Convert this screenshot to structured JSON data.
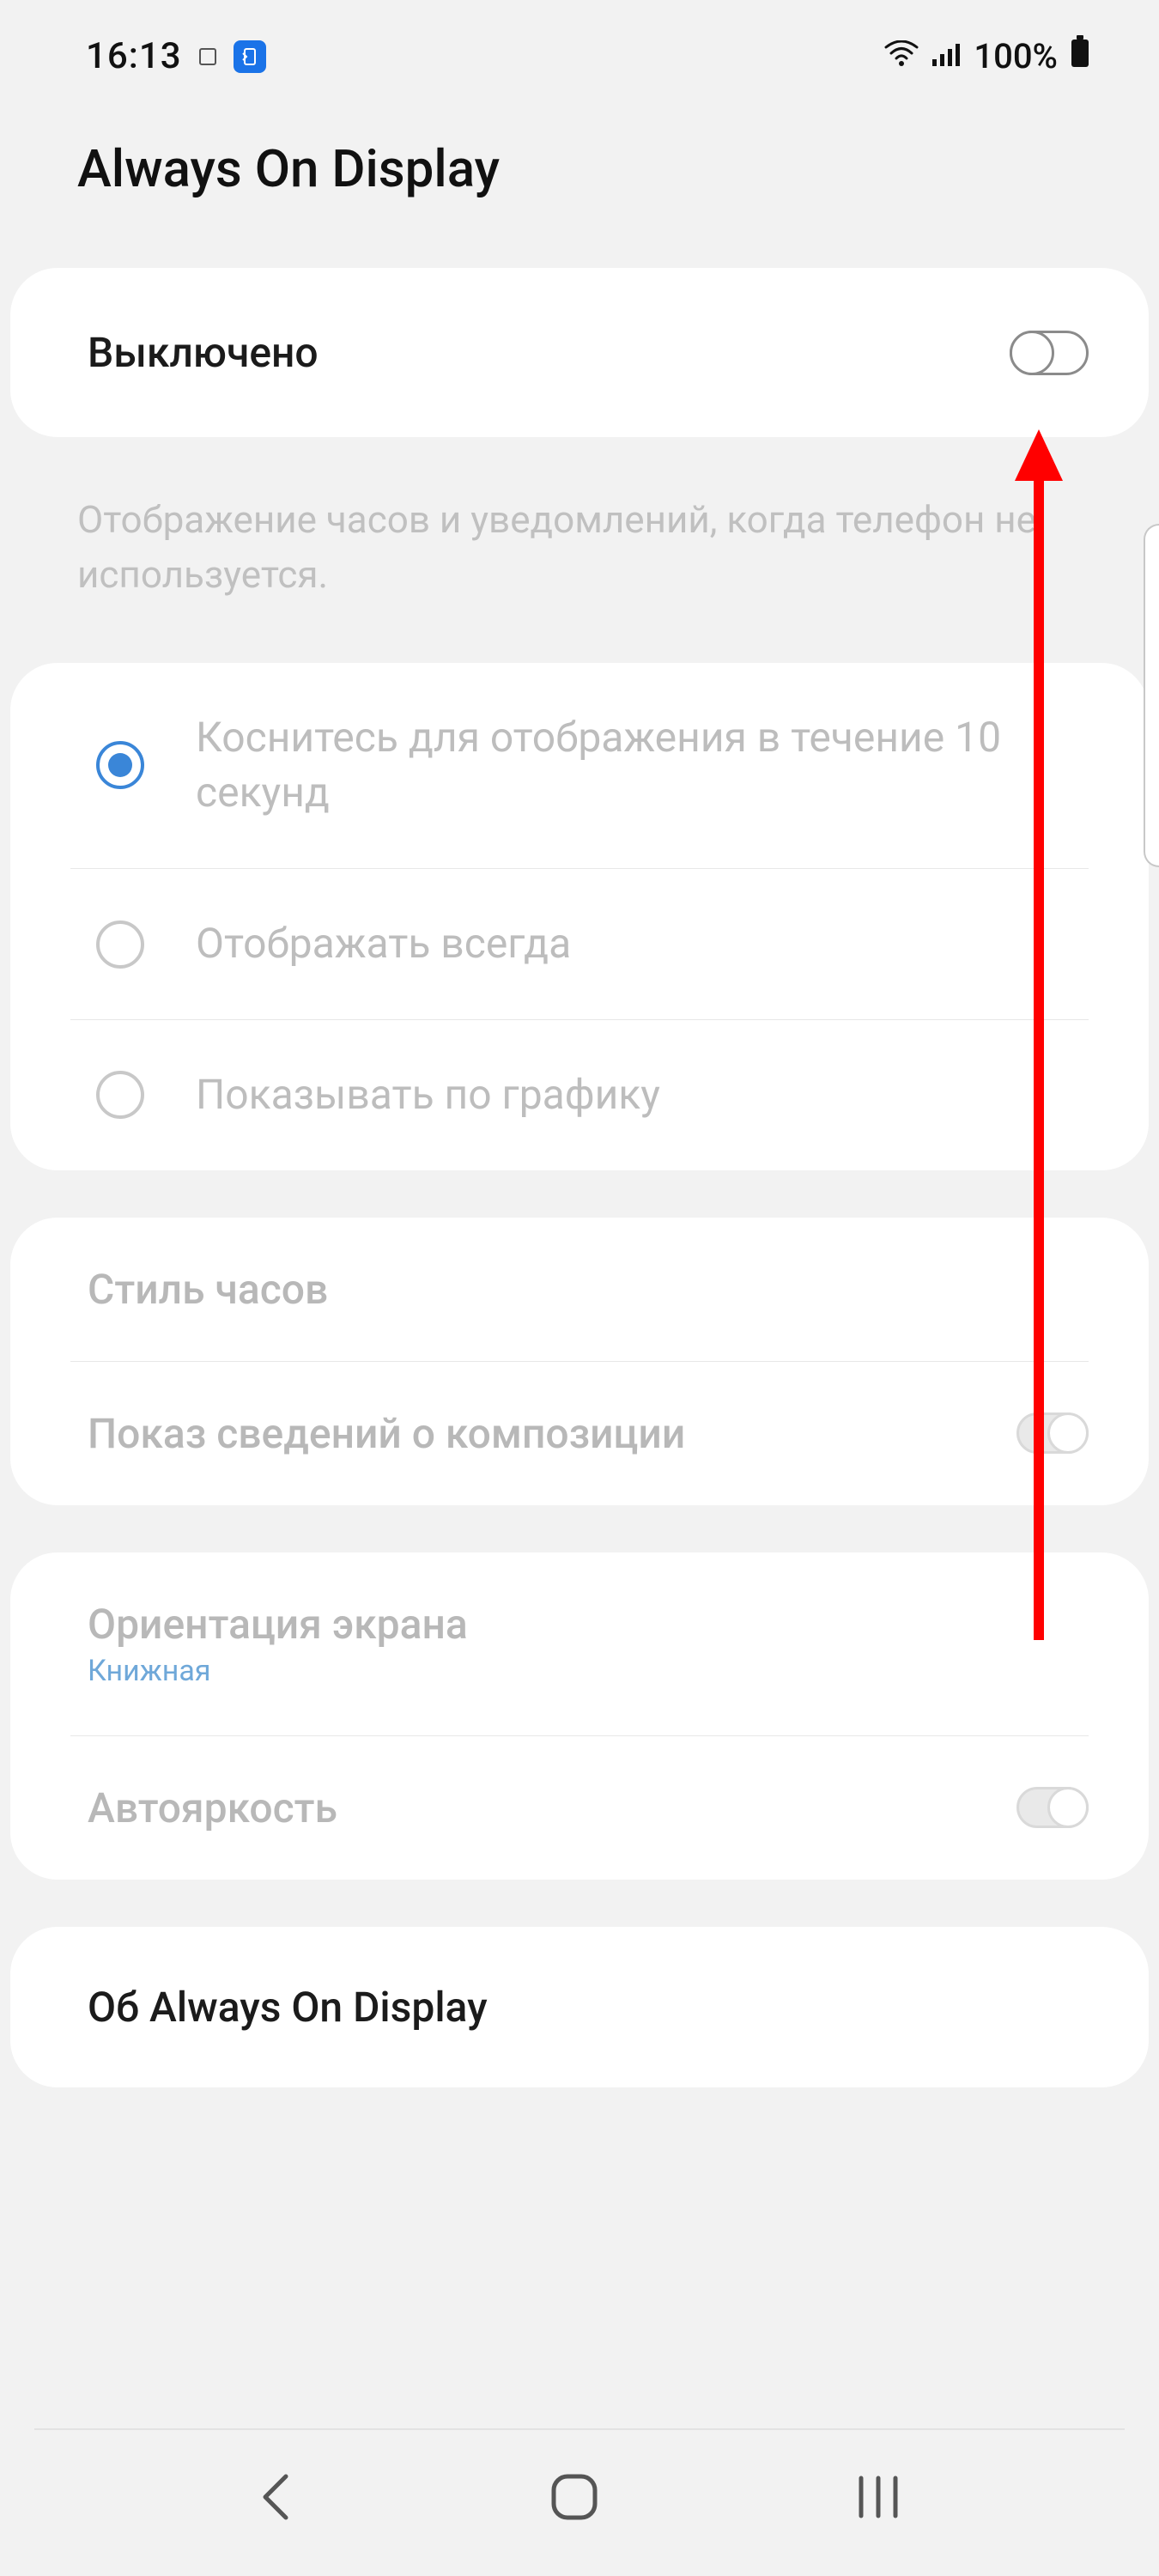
{
  "status": {
    "time": "16:13",
    "battery_text": "100%"
  },
  "title": "Always On Display",
  "master": {
    "state_label": "Выключено",
    "enabled": false
  },
  "description": "Отображение часов и уведомлений, когда телефон не используется.",
  "display_mode": {
    "options": [
      "Коснитесь для отображения в течение 10 секунд",
      "Отображать всегда",
      "Показывать по графику"
    ],
    "selected_index": 0
  },
  "style_section": {
    "clock_style": "Стиль часов",
    "music_info": "Показ сведений о композиции",
    "music_info_enabled": false
  },
  "orientation_section": {
    "title": "Ориентация экрана",
    "value": "Книжная",
    "auto_brightness": "Автояркость",
    "auto_brightness_enabled": false
  },
  "about": "Об Always On Display"
}
